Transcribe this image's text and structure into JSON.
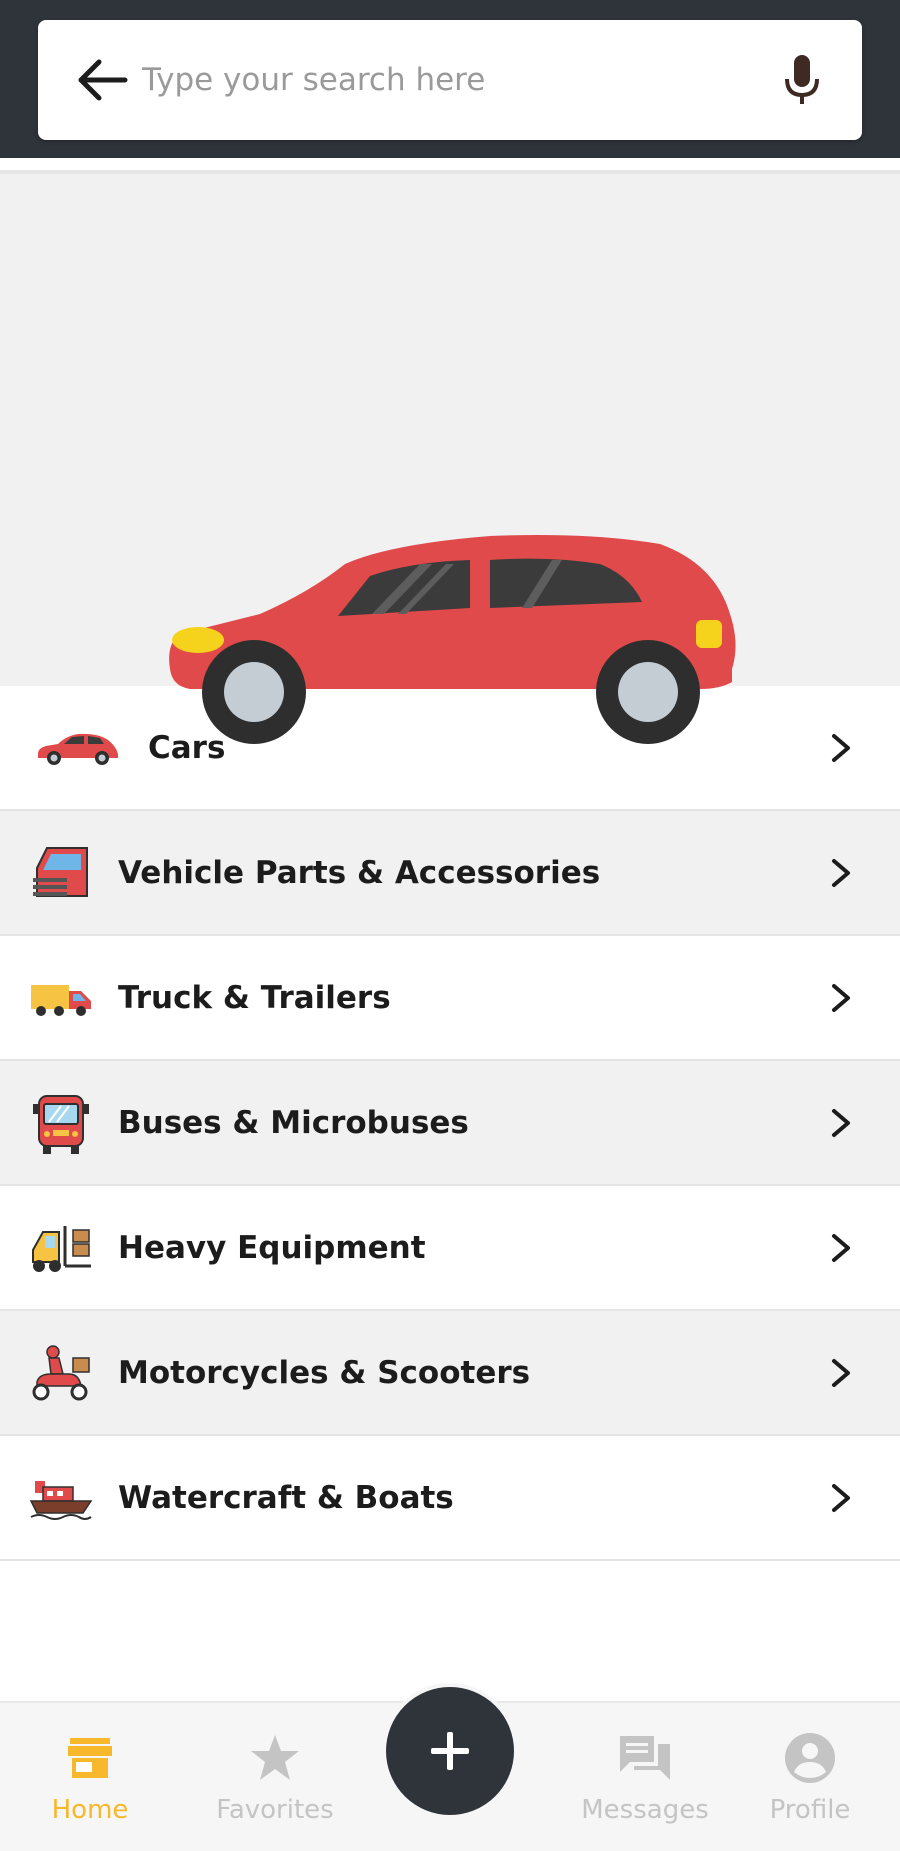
{
  "search": {
    "placeholder": "Type your search here",
    "value": ""
  },
  "hero": {
    "icon": "car-icon",
    "accent_color": "#e04a4a"
  },
  "categories": [
    {
      "label": "Cars",
      "icon": "car-icon"
    },
    {
      "label": "Vehicle Parts & Accessories",
      "icon": "car-door-icon"
    },
    {
      "label": "Truck & Trailers",
      "icon": "truck-icon"
    },
    {
      "label": "Buses & Microbuses",
      "icon": "bus-icon"
    },
    {
      "label": "Heavy Equipment",
      "icon": "forklift-icon"
    },
    {
      "label": "Motorcycles & Scooters",
      "icon": "scooter-icon"
    },
    {
      "label": "Watercraft & Boats",
      "icon": "boat-icon"
    }
  ],
  "nav": {
    "home": "Home",
    "favorites": "Favorites",
    "messages": "Messages",
    "profile": "Profile",
    "active": "Home",
    "active_color": "#f7b82b",
    "inactive_color": "#c4c4c4"
  },
  "fab": {
    "icon": "plus-icon"
  }
}
